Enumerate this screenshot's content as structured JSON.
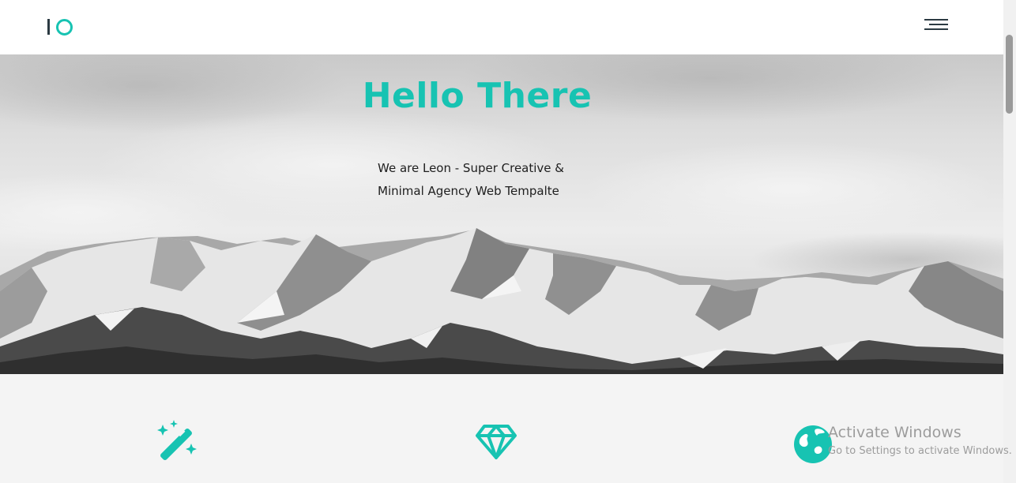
{
  "header": {
    "logo": "IO",
    "menu_icon": "hamburger-menu-icon"
  },
  "hero": {
    "title": "Hello There",
    "subtitle_line1": "We are Leon - Super Creative &",
    "subtitle_line2": "Minimal Agency Web Tempalte"
  },
  "features": {
    "icons": [
      "magic-wand-icon",
      "diamond-icon",
      "globe-icon"
    ]
  },
  "colors": {
    "accent": "#17c3b2",
    "dark": "#2b3a42",
    "features_bg": "#f4f4f4"
  },
  "os_overlay": {
    "line1": "Activate Windows",
    "line2": "Go to Settings to activate Windows."
  }
}
